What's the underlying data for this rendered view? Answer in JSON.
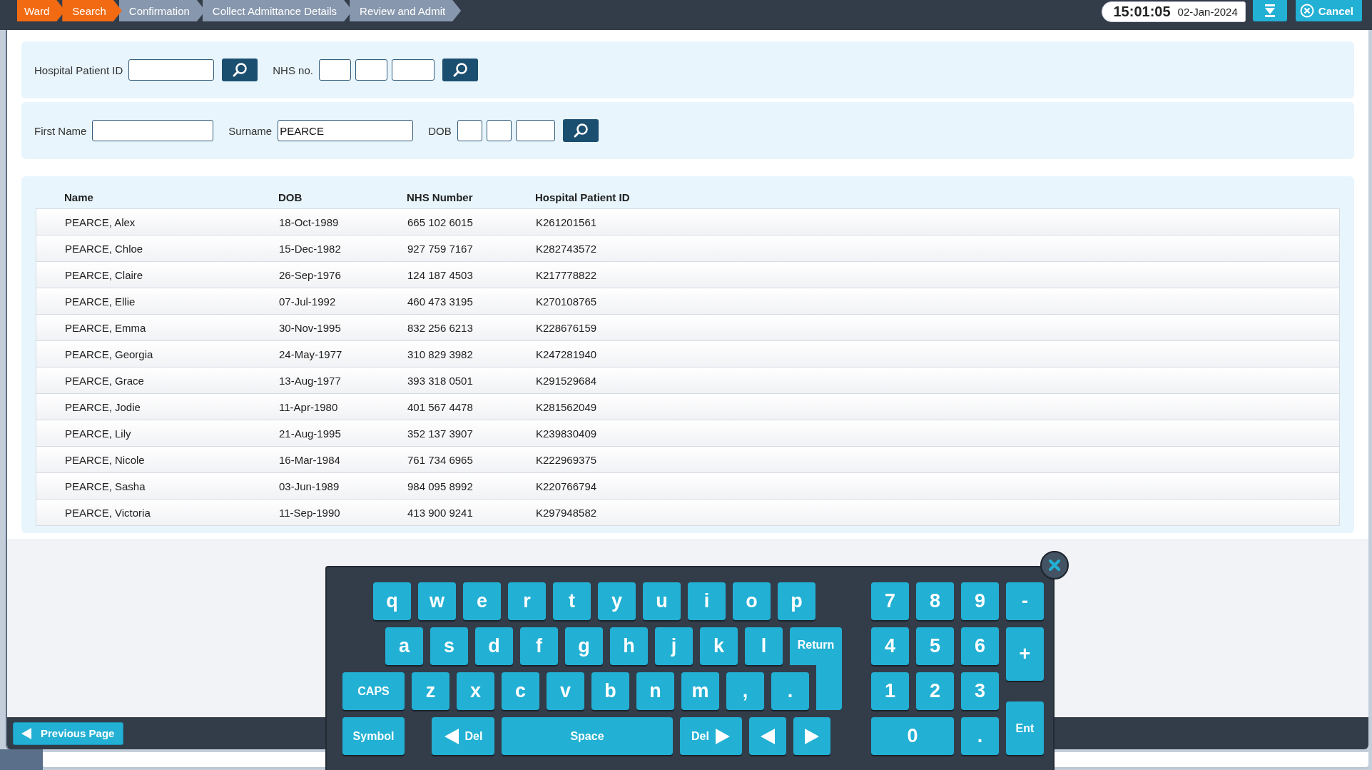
{
  "breadcrumbs": [
    {
      "label": "Ward",
      "active": true
    },
    {
      "label": "Search",
      "active": true
    },
    {
      "label": "Confirmation",
      "active": false
    },
    {
      "label": "Collect Admittance Details",
      "active": false
    },
    {
      "label": "Review and Admit",
      "active": false
    }
  ],
  "clock": {
    "time": "15:01:05",
    "date": "02-Jan-2024"
  },
  "cancel_button": "Cancel",
  "search_rows": [
    {
      "fields": [
        {
          "label": "Hospital Patient ID",
          "kind": "single"
        },
        {
          "label": "NHS no.",
          "kind": "triple"
        }
      ]
    },
    {
      "fields": [
        {
          "label": "First Name",
          "kind": "single"
        },
        {
          "label": "Surname",
          "kind": "single",
          "value": "PEARCE"
        },
        {
          "label": "DOB",
          "kind": "triple"
        }
      ]
    }
  ],
  "results": {
    "columns": [
      "Name",
      "DOB",
      "NHS Number",
      "Hospital Patient ID"
    ],
    "rows": [
      [
        "PEARCE, Alex",
        "18-Oct-1989",
        "665 102 6015",
        "K261201561"
      ],
      [
        "PEARCE, Chloe",
        "15-Dec-1982",
        "927 759 7167",
        "K282743572"
      ],
      [
        "PEARCE, Claire",
        "26-Sep-1976",
        "124 187 4503",
        "K217778822"
      ],
      [
        "PEARCE, Ellie",
        "07-Jul-1992",
        "460 473 3195",
        "K270108765"
      ],
      [
        "PEARCE, Emma",
        "30-Nov-1995",
        "832 256 6213",
        "K228676159"
      ],
      [
        "PEARCE, Georgia",
        "24-May-1977",
        "310 829 3982",
        "K247281940"
      ],
      [
        "PEARCE, Grace",
        "13-Aug-1977",
        "393 318 0501",
        "K291529684"
      ],
      [
        "PEARCE, Jodie",
        "11-Apr-1980",
        "401 567 4478",
        "K281562049"
      ],
      [
        "PEARCE, Lily",
        "21-Aug-1995",
        "352 137 3907",
        "K239830409"
      ],
      [
        "PEARCE, Nicole",
        "16-Mar-1984",
        "761 734 6965",
        "K222969375"
      ],
      [
        "PEARCE, Sasha",
        "03-Jun-1989",
        "984 095 8992",
        "K220766794"
      ],
      [
        "PEARCE, Victoria",
        "11-Sep-1990",
        "413 900 9241",
        "K297948582"
      ]
    ]
  },
  "previous_page_button": "Previous Page",
  "keyboard": {
    "rows": [
      {
        "keys": [
          {
            "label": "q",
            "kind": "char"
          },
          {
            "label": "w",
            "kind": "char"
          },
          {
            "label": "e",
            "kind": "char"
          },
          {
            "label": "r",
            "kind": "char"
          },
          {
            "label": "t",
            "kind": "char"
          },
          {
            "label": "y",
            "kind": "char"
          },
          {
            "label": "u",
            "kind": "char"
          },
          {
            "label": "i",
            "kind": "char"
          },
          {
            "label": "o",
            "kind": "char"
          },
          {
            "label": "p",
            "kind": "char"
          }
        ]
      },
      {
        "keys": [
          {
            "label": "a",
            "kind": "char"
          },
          {
            "label": "s",
            "kind": "char"
          },
          {
            "label": "d",
            "kind": "char"
          },
          {
            "label": "f",
            "kind": "char"
          },
          {
            "label": "g",
            "kind": "char"
          },
          {
            "label": "h",
            "kind": "char"
          },
          {
            "label": "j",
            "kind": "char"
          },
          {
            "label": "k",
            "kind": "char"
          },
          {
            "label": "l",
            "kind": "char"
          },
          {
            "label": "Return",
            "kind": "return"
          }
        ]
      },
      {
        "keys": [
          {
            "label": "CAPS",
            "kind": "caps"
          },
          {
            "label": "z",
            "kind": "char"
          },
          {
            "label": "x",
            "kind": "char"
          },
          {
            "label": "c",
            "kind": "char"
          },
          {
            "label": "v",
            "kind": "char"
          },
          {
            "label": "b",
            "kind": "char"
          },
          {
            "label": "n",
            "kind": "char"
          },
          {
            "label": "m",
            "kind": "char"
          },
          {
            "label": ",",
            "kind": "char"
          },
          {
            "label": ".",
            "kind": "char"
          }
        ]
      },
      {
        "keys": [
          {
            "label": "Symbol",
            "kind": "symbol"
          },
          {
            "label": "Del",
            "kind": "del-back"
          },
          {
            "label": "Space",
            "kind": "space"
          },
          {
            "label": "Del",
            "kind": "del-forward"
          },
          {
            "kind": "left"
          },
          {
            "kind": "right"
          }
        ]
      }
    ],
    "numpad": [
      {
        "label": "7",
        "kind": "num"
      },
      {
        "label": "8",
        "kind": "num"
      },
      {
        "label": "9",
        "kind": "num"
      },
      {
        "label": "-",
        "kind": "minus"
      },
      {
        "label": "4",
        "kind": "num"
      },
      {
        "label": "5",
        "kind": "num"
      },
      {
        "label": "6",
        "kind": "num"
      },
      {
        "label": "+",
        "kind": "plus"
      },
      {
        "label": "1",
        "kind": "num"
      },
      {
        "label": "2",
        "kind": "num"
      },
      {
        "label": "3",
        "kind": "num"
      },
      {
        "label": "0",
        "kind": "zero"
      },
      {
        "label": ".",
        "kind": "num"
      },
      {
        "label": "Ent",
        "kind": "enter"
      }
    ]
  }
}
